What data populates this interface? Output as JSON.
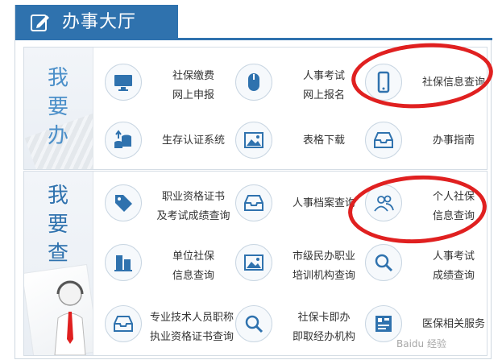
{
  "header": {
    "title": "办事大厅"
  },
  "sections": [
    {
      "side_label": "我要办",
      "items": [
        {
          "lines": [
            "社保缴费",
            "网上申报"
          ],
          "icon": "monitor-icon"
        },
        {
          "lines": [
            "人事考试",
            "网上报名"
          ],
          "icon": "mouse-icon"
        },
        {
          "lines": [
            "社保信息查询"
          ],
          "icon": "phone-icon"
        },
        {
          "lines": [
            "生存认证系统"
          ],
          "icon": "coins-upload-icon"
        },
        {
          "lines": [
            "表格下载"
          ],
          "icon": "image-icon"
        },
        {
          "lines": [
            "办事指南"
          ],
          "icon": "inbox-icon"
        }
      ]
    },
    {
      "side_label": "我要查",
      "items": [
        {
          "lines": [
            "职业资格证书",
            "及考试成绩查询"
          ],
          "icon": "tag-icon"
        },
        {
          "lines": [
            "人事档案查询"
          ],
          "icon": "inbox-icon"
        },
        {
          "lines": [
            "个人社保",
            "信息查询"
          ],
          "icon": "users-icon"
        },
        {
          "lines": [
            "单位社保",
            "信息查询"
          ],
          "icon": "building-icon"
        },
        {
          "lines": [
            "市级民办职业",
            "培训机构查询"
          ],
          "icon": "image-icon"
        },
        {
          "lines": [
            "人事考试",
            "成绩查询"
          ],
          "icon": "search-icon"
        },
        {
          "lines": [
            "专业技术人员职称",
            "执业资格证书查询"
          ],
          "icon": "inbox-icon"
        },
        {
          "lines": [
            "社保卡即办",
            "即取经办机构"
          ],
          "icon": "search-icon"
        },
        {
          "lines": [
            "医保相关服务"
          ],
          "icon": "grid-icon"
        }
      ]
    }
  ],
  "watermark": "Baidu 经验",
  "colors": {
    "accent": "#2f72ae",
    "highlight_oval": "#e02020",
    "side_text": "#4b8fc9"
  }
}
